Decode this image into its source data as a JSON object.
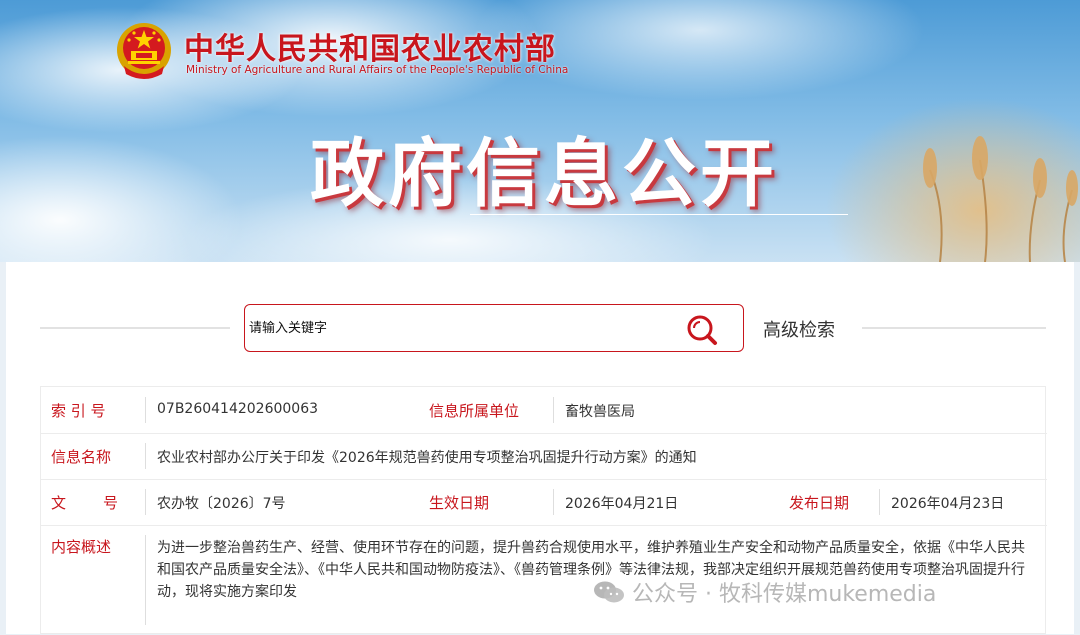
{
  "header": {
    "ministry_cn": "中华人民共和国农业农村部",
    "ministry_en": "Ministry of Agriculture and Rural Affairs of the People's Republic of China",
    "banner_title": "政府信息公开"
  },
  "search": {
    "placeholder": "请输入关键字",
    "value": "",
    "advanced_label": "高级检索"
  },
  "info": {
    "index_label": "索 引 号",
    "index_value": "07B260414202600063",
    "org_label": "信息所属单位",
    "org_value": "畜牧兽医局",
    "name_label": "信息名称",
    "name_value": "农业农村部办公厅关于印发《2026年规范兽药使用专项整治巩固提升行动方案》的通知",
    "doc_label_1": "文",
    "doc_label_2": "号",
    "doc_value": "农办牧〔2026〕7号",
    "effective_label": "生效日期",
    "effective_value": "2026年04月21日",
    "publish_label": "发布日期",
    "publish_value": "2026年04月23日",
    "summary_label": "内容概述",
    "summary_value": "为进一步整治兽药生产、经营、使用环节存在的问题，提升兽药合规使用水平，维护养殖业生产安全和动物产品质量安全，依据《中华人民共和国农产品质量安全法》、《中华人民共和国动物防疫法》、《兽药管理条例》等法律法规，我部决定组织开展规范兽药使用专项整治巩固提升行动，现将实施方案印发"
  },
  "watermark": {
    "text": "公众号 · 牧科传媒mukemedia"
  },
  "colors": {
    "brand_red": "#c8161d",
    "sky_blue": "#4d9bd6"
  },
  "icons": [
    "national-emblem-icon",
    "search-icon",
    "wechat-icon"
  ]
}
